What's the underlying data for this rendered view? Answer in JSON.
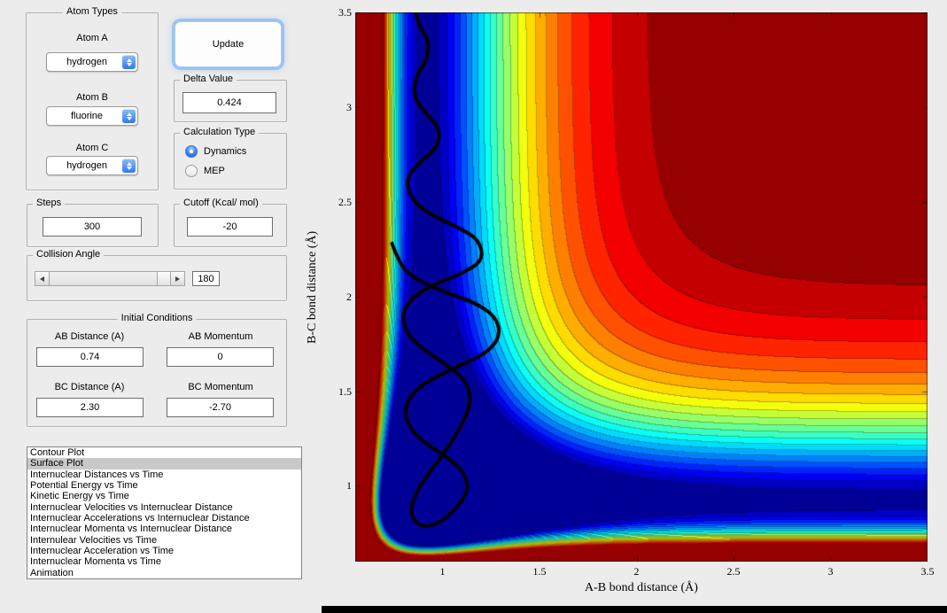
{
  "window": {
    "background_color": "#ececec",
    "bottom_edge_color": "#000000"
  },
  "atom_types": {
    "title": "Atom Types",
    "fields": [
      {
        "label": "Atom A",
        "value": "hydrogen"
      },
      {
        "label": "Atom B",
        "value": "fluorine"
      },
      {
        "label": "Atom C",
        "value": "hydrogen"
      }
    ]
  },
  "update_button": {
    "label": "Update"
  },
  "delta": {
    "title": "Delta Value",
    "value": "0.424"
  },
  "calculation_type": {
    "title": "Calculation Type",
    "options": [
      {
        "label": "Dynamics",
        "selected": true
      },
      {
        "label": "MEP",
        "selected": false
      }
    ]
  },
  "steps": {
    "title": "Steps",
    "value": "300"
  },
  "cutoff": {
    "title": "Cutoff (Kcal/ mol)",
    "value": "-20"
  },
  "collision_angle": {
    "title": "Collision Angle",
    "value": "180"
  },
  "initial_conditions": {
    "title": "Initial Conditions",
    "fields": [
      {
        "label": "AB Distance (A)",
        "value": "0.74"
      },
      {
        "label": "AB Momentum",
        "value": "0"
      },
      {
        "label": "BC Distance (A)",
        "value": "2.30"
      },
      {
        "label": "BC Momentum",
        "value": "-2.70"
      }
    ]
  },
  "plot_list": {
    "selected_index": 1,
    "items": [
      "Contour Plot",
      "Surface Plot",
      "Internuclear Distances vs Time",
      "Potential Energy vs Time",
      "Kinetic Energy vs Time",
      "Internuclear Velocities vs Internuclear Distance",
      "Internuclear Accelerations vs Internuclear Distance",
      "Internuclear Momenta vs Internuclear Distance",
      "Internulear Velocities vs Time",
      "Internuclear Acceleration vs Time",
      "Internuclear Momenta vs Time",
      "Animation"
    ]
  },
  "chart_data": {
    "type": "heatmap",
    "subtype": "filled-contour-potential-energy-surface",
    "xlabel": "A-B bond distance (Å)",
    "ylabel": "B-C bond distance (Å)",
    "x_range": [
      0.55,
      3.5
    ],
    "y_range": [
      0.6,
      3.5
    ],
    "x_ticks": [
      1,
      1.5,
      2,
      2.5,
      3,
      3.5
    ],
    "y_ticks": [
      1,
      1.5,
      2,
      2.5,
      3,
      3.5
    ],
    "colormap": "jet",
    "levels": 22,
    "grid": false,
    "legend": false,
    "surface_model": {
      "type": "morse-sum",
      "r0": 0.92,
      "alpha": 3.0,
      "depth": 1,
      "color_vmin": -1.02,
      "color_vmax": -0.02
    },
    "trajectory": {
      "color": "#000000",
      "width": 4,
      "points": [
        [
          0.74,
          2.28
        ],
        [
          0.78,
          2.16
        ],
        [
          0.88,
          2.08
        ],
        [
          1.02,
          2.02
        ],
        [
          1.16,
          1.97
        ],
        [
          1.27,
          1.9
        ],
        [
          1.3,
          1.8
        ],
        [
          1.24,
          1.71
        ],
        [
          1.1,
          1.64
        ],
        [
          0.95,
          1.57
        ],
        [
          0.84,
          1.49
        ],
        [
          0.8,
          1.39
        ],
        [
          0.84,
          1.29
        ],
        [
          0.93,
          1.21
        ],
        [
          1.04,
          1.14
        ],
        [
          1.12,
          1.06
        ],
        [
          1.13,
          0.97
        ],
        [
          1.07,
          0.88
        ],
        [
          0.98,
          0.8
        ],
        [
          0.89,
          0.78
        ],
        [
          0.83,
          0.85
        ],
        [
          0.86,
          0.96
        ],
        [
          0.93,
          1.07
        ],
        [
          1.02,
          1.19
        ],
        [
          1.1,
          1.32
        ],
        [
          1.15,
          1.45
        ],
        [
          1.12,
          1.56
        ],
        [
          1.02,
          1.64
        ],
        [
          0.9,
          1.72
        ],
        [
          0.81,
          1.81
        ],
        [
          0.79,
          1.92
        ],
        [
          0.86,
          2.01
        ],
        [
          0.97,
          2.07
        ],
        [
          1.1,
          2.12
        ],
        [
          1.21,
          2.19
        ],
        [
          1.19,
          2.3
        ],
        [
          1.07,
          2.37
        ],
        [
          0.94,
          2.43
        ],
        [
          0.84,
          2.51
        ],
        [
          0.81,
          2.62
        ],
        [
          0.88,
          2.71
        ],
        [
          0.97,
          2.78
        ],
        [
          0.99,
          2.88
        ],
        [
          0.92,
          2.96
        ],
        [
          0.85,
          3.05
        ],
        [
          0.86,
          3.16
        ],
        [
          0.92,
          3.25
        ],
        [
          0.93,
          3.35
        ],
        [
          0.88,
          3.43
        ],
        [
          0.86,
          3.5
        ]
      ]
    }
  }
}
